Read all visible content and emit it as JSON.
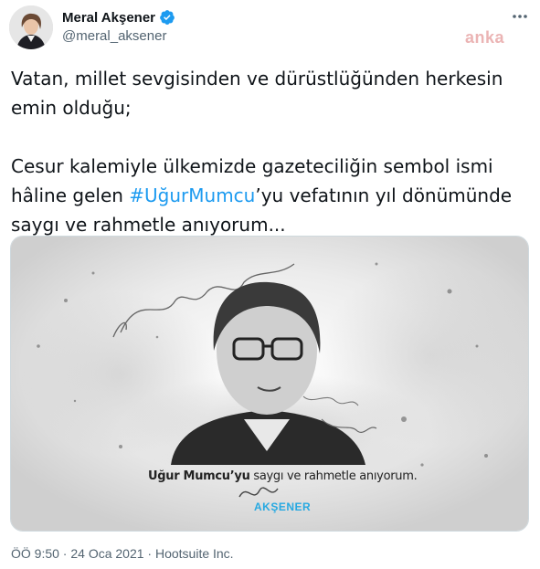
{
  "tweet": {
    "display_name": "Meral Akşener",
    "handle": "@meral_aksener",
    "watermark": "anka",
    "text_line1": "Vatan, millet sevgisinden ve dürüstlüğünden herkesin",
    "text_line2": "emin olduğu;",
    "text_line3": "Cesur kalemiyle ülkemizde gazeteciliğin sembol ismi",
    "text_line4_pre": "hâline gelen ",
    "hashtag": "#UğurMumcu",
    "text_line4_post": "’yu vefatının yıl dönümünde",
    "text_line5": "saygı ve rahmetle anıyorum...",
    "timestamp": "ÖÖ 9:50 · 24 Oca 2021 · Hootsuite Inc."
  },
  "media": {
    "caption_bold": "Uğur Mumcu’yu",
    "caption_rest": " saygı ve rahmetle anıyorum.",
    "logo": "AKŞENER"
  },
  "colors": {
    "link": "#1d9bf0",
    "verified": "#1d9bf0",
    "muted": "#536471"
  },
  "icons": [
    "verified-badge-icon",
    "more-options-icon"
  ]
}
